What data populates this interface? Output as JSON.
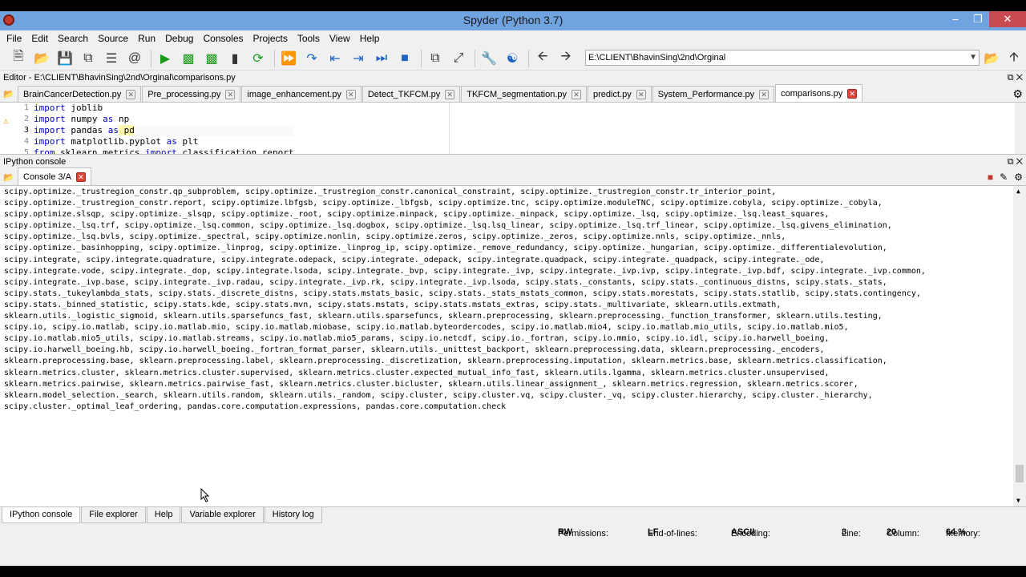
{
  "window": {
    "title": "Spyder (Python 3.7)"
  },
  "menu": [
    "File",
    "Edit",
    "Search",
    "Source",
    "Run",
    "Debug",
    "Consoles",
    "Projects",
    "Tools",
    "View",
    "Help"
  ],
  "toolbar": {
    "path": "E:\\CLIENT\\BhavinSing\\2nd\\Orginal"
  },
  "editor": {
    "header": "Editor - E:\\CLIENT\\BhavinSing\\2nd\\Orginal\\comparisons.py",
    "tabs": [
      "BrainCancerDetection.py",
      "Pre_processing.py",
      "image_enhancement.py",
      "Detect_TKFCM.py",
      "TKFCM_segmentation.py",
      "predict.py",
      "System_Performance.py",
      "comparisons.py"
    ],
    "active_tab": "comparisons.py",
    "line_numbers": [
      "1",
      "2",
      "3",
      "4",
      "5"
    ],
    "lines": [
      {
        "kw": "import",
        "rest": " joblib"
      },
      {
        "kw": "import",
        "rest": " numpy ",
        "kw2": "as",
        "rest2": " np"
      },
      {
        "kw": "import",
        "rest": " pandas ",
        "kw2": "as",
        "rest2": " pd"
      },
      {
        "kw": "import",
        "rest": " matplotlib.pyplot ",
        "kw2": "as",
        "rest2": " plt"
      },
      {
        "kw": "from",
        "rest": " sklearn.metrics ",
        "kw2": "import",
        "rest2": " classification_report"
      }
    ]
  },
  "console": {
    "header": "IPython console",
    "tab": "Console 3/A",
    "lines": [
      "scipy.optimize._trustregion_constr.qp_subproblem, scipy.optimize._trustregion_constr.canonical_constraint, scipy.optimize._trustregion_constr.tr_interior_point,",
      "scipy.optimize._trustregion_constr.report, scipy.optimize.lbfgsb, scipy.optimize._lbfgsb, scipy.optimize.tnc, scipy.optimize.moduleTNC, scipy.optimize.cobyla, scipy.optimize._cobyla,",
      "scipy.optimize.slsqp, scipy.optimize._slsqp, scipy.optimize._root, scipy.optimize.minpack, scipy.optimize._minpack, scipy.optimize._lsq, scipy.optimize._lsq.least_squares,",
      "scipy.optimize._lsq.trf, scipy.optimize._lsq.common, scipy.optimize._lsq.dogbox, scipy.optimize._lsq.lsq_linear, scipy.optimize._lsq.trf_linear, scipy.optimize._lsq.givens_elimination,",
      "scipy.optimize._lsq.bvls, scipy.optimize._spectral, scipy.optimize.nonlin, scipy.optimize.zeros, scipy.optimize._zeros, scipy.optimize.nnls, scipy.optimize._nnls,",
      "scipy.optimize._basinhopping, scipy.optimize._linprog, scipy.optimize._linprog_ip, scipy.optimize._remove_redundancy, scipy.optimize._hungarian, scipy.optimize._differentialevolution,",
      "scipy.integrate, scipy.integrate.quadrature, scipy.integrate.odepack, scipy.integrate._odepack, scipy.integrate.quadpack, scipy.integrate._quadpack, scipy.integrate._ode,",
      "scipy.integrate.vode, scipy.integrate._dop, scipy.integrate.lsoda, scipy.integrate._bvp, scipy.integrate._ivp, scipy.integrate._ivp.ivp, scipy.integrate._ivp.bdf, scipy.integrate._ivp.common,",
      "scipy.integrate._ivp.base, scipy.integrate._ivp.radau, scipy.integrate._ivp.rk, scipy.integrate._ivp.lsoda, scipy.stats._constants, scipy.stats._continuous_distns, scipy.stats._stats,",
      "scipy.stats._tukeylambda_stats, scipy.stats._discrete_distns, scipy.stats.mstats_basic, scipy.stats._stats_mstats_common, scipy.stats.morestats, scipy.stats.statlib, scipy.stats.contingency,",
      "scipy.stats._binned_statistic, scipy.stats.kde, scipy.stats.mvn, scipy.stats.mstats, scipy.stats.mstats_extras, scipy.stats._multivariate, sklearn.utils.extmath,",
      "sklearn.utils._logistic_sigmoid, sklearn.utils.sparsefuncs_fast, sklearn.utils.sparsefuncs, sklearn.preprocessing, sklearn.preprocessing._function_transformer, sklearn.utils.testing,",
      "scipy.io, scipy.io.matlab, scipy.io.matlab.mio, scipy.io.matlab.miobase, scipy.io.matlab.byteordercodes, scipy.io.matlab.mio4, scipy.io.matlab.mio_utils, scipy.io.matlab.mio5,",
      "scipy.io.matlab.mio5_utils, scipy.io.matlab.streams, scipy.io.matlab.mio5_params, scipy.io.netcdf, scipy.io._fortran, scipy.io.mmio, scipy.io.idl, scipy.io.harwell_boeing,",
      "scipy.io.harwell_boeing.hb, scipy.io.harwell_boeing._fortran_format_parser, sklearn.utils._unittest_backport, sklearn.preprocessing.data, sklearn.preprocessing._encoders,",
      "sklearn.preprocessing.base, sklearn.preprocessing.label, sklearn.preprocessing._discretization, sklearn.preprocessing.imputation, sklearn.metrics.base, sklearn.metrics.classification,",
      "sklearn.metrics.cluster, sklearn.metrics.cluster.supervised, sklearn.metrics.cluster.expected_mutual_info_fast, sklearn.utils.lgamma, sklearn.metrics.cluster.unsupervised,",
      "sklearn.metrics.pairwise, sklearn.metrics.pairwise_fast, sklearn.metrics.cluster.bicluster, sklearn.utils.linear_assignment_, sklearn.metrics.regression, sklearn.metrics.scorer,",
      "sklearn.model_selection._search, sklearn.utils.random, sklearn.utils._random, scipy.cluster, scipy.cluster.vq, scipy.cluster._vq, scipy.cluster.hierarchy, scipy.cluster._hierarchy,",
      "scipy.cluster._optimal_leaf_ordering, pandas.core.computation.expressions, pandas.core.computation.check"
    ]
  },
  "bottom_tabs": [
    "IPython console",
    "File explorer",
    "Help",
    "Variable explorer",
    "History log"
  ],
  "status": {
    "permissions_label": "Permissions:",
    "permissions": "RW",
    "eol_label": "End-of-lines:",
    "eol": "LF",
    "encoding_label": "Encoding:",
    "encoding": "ASCII",
    "line_label": "Line:",
    "line": "3",
    "column_label": "Column:",
    "column": "20",
    "memory_label": "Memory:",
    "memory": "64 %"
  }
}
